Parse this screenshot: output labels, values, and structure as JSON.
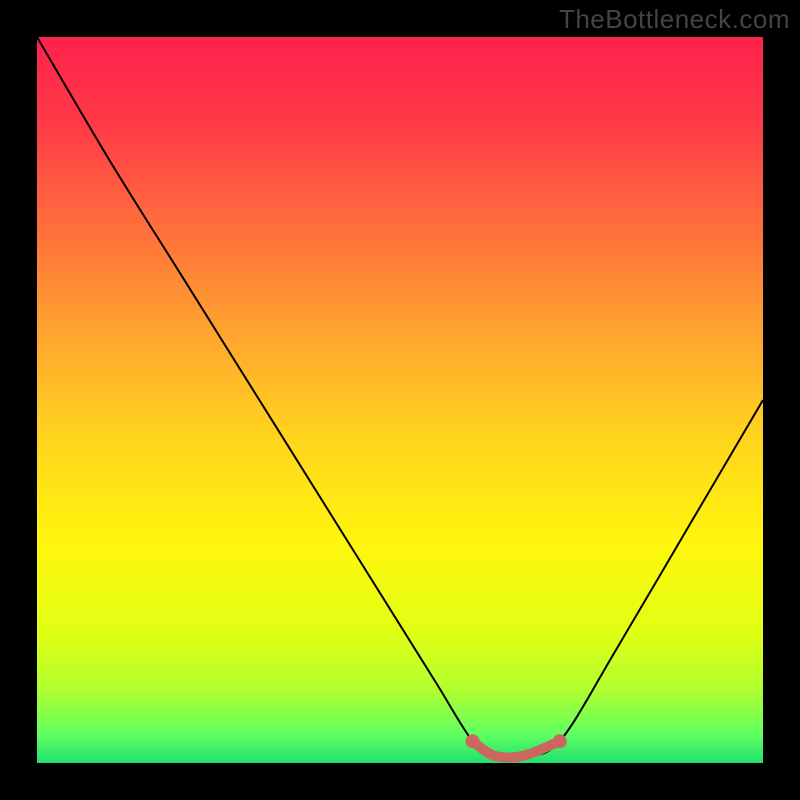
{
  "watermark": "TheBottleneck.com",
  "chart_data": {
    "type": "line",
    "title": "",
    "xlabel": "",
    "ylabel": "",
    "xlim": [
      0,
      100
    ],
    "ylim": [
      0,
      100
    ],
    "x": [
      0,
      10,
      20,
      30,
      40,
      50,
      55,
      60,
      63,
      67,
      72,
      80,
      90,
      100
    ],
    "y": [
      100,
      83,
      67,
      51,
      35,
      19,
      11,
      3,
      1,
      1,
      3,
      16,
      33,
      50
    ],
    "highlight": {
      "color": "#cc6660",
      "x": [
        60,
        63,
        67,
        72
      ],
      "y": [
        3,
        1,
        1,
        3
      ]
    },
    "background_gradient": {
      "type": "vertical",
      "stops": [
        {
          "pos": 0.0,
          "color": "#ff214d"
        },
        {
          "pos": 0.12,
          "color": "#ff3a47"
        },
        {
          "pos": 0.25,
          "color": "#ff6a3d"
        },
        {
          "pos": 0.4,
          "color": "#ffa22f"
        },
        {
          "pos": 0.55,
          "color": "#ffd41e"
        },
        {
          "pos": 0.7,
          "color": "#fff60c"
        },
        {
          "pos": 0.82,
          "color": "#e0ff14"
        },
        {
          "pos": 0.9,
          "color": "#b0ff30"
        },
        {
          "pos": 0.96,
          "color": "#60ff60"
        },
        {
          "pos": 1.0,
          "color": "#20e070"
        }
      ]
    },
    "line_color": "#000000",
    "line_width": 2
  }
}
